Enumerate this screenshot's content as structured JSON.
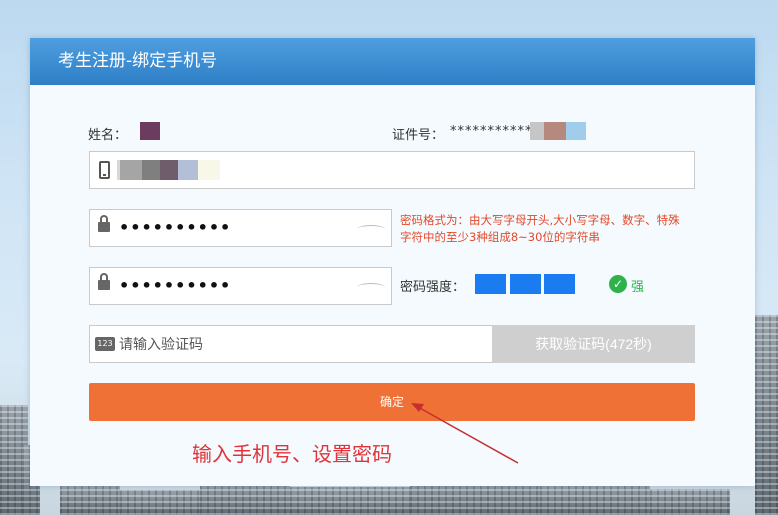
{
  "header": {
    "title": "考生注册-绑定手机号"
  },
  "info": {
    "name_label": "姓名：",
    "id_label": "证件号：",
    "id_value": "***********"
  },
  "phone": {
    "icon": "mobile-phone-icon"
  },
  "password": {
    "value": "••••••••••",
    "confirm_value": "••••••••••",
    "hint": "密码格式为：由大写字母开头,大小写字母、数字、特殊字符中的至少3种组成8~30位的字符串",
    "strength_label": "密码强度：",
    "strength_text": "强",
    "strength_level": 3,
    "strength_max": 3
  },
  "verify": {
    "icon_text": "123",
    "placeholder": "请输入验证码",
    "get_code_label": "获取验证码(472秒)"
  },
  "confirm": {
    "label": "确定"
  },
  "annotation": {
    "text": "输入手机号、设置密码"
  },
  "colors": {
    "header": "#3a8ad3",
    "confirm_button": "#f07136",
    "hint_text": "#e34a2a",
    "strength_bar": "#1a7cf0",
    "strength_ok": "#2fb24c",
    "annotation": "#e0343b"
  }
}
